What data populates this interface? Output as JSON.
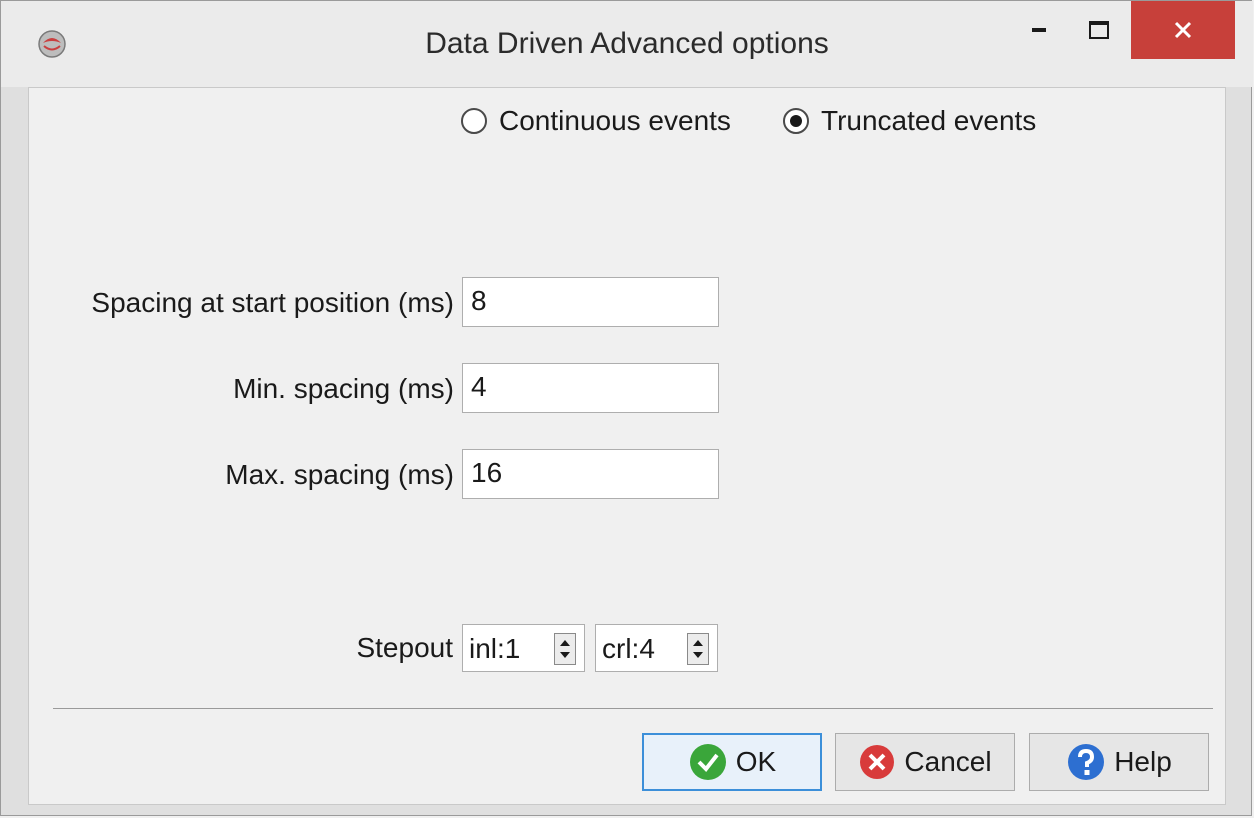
{
  "window": {
    "title": "Data Driven Advanced options"
  },
  "event_mode": {
    "options": [
      "Continuous events",
      "Truncated events"
    ],
    "selected": "Truncated events"
  },
  "fields": {
    "spacing_start": {
      "label": "Spacing at start position (ms)",
      "value": "8"
    },
    "min_spacing": {
      "label": "Min. spacing (ms)",
      "value": "4"
    },
    "max_spacing": {
      "label": "Max. spacing (ms)",
      "value": "16"
    }
  },
  "stepout": {
    "label": "Stepout",
    "inl": "inl:1",
    "crl": "crl:4"
  },
  "buttons": {
    "ok": "OK",
    "cancel": "Cancel",
    "help": "Help"
  },
  "colors": {
    "close_button": "#c7403a",
    "ok_icon": "#3aa63a",
    "cancel_icon": "#d83b3b",
    "help_icon": "#2d6fd1"
  }
}
